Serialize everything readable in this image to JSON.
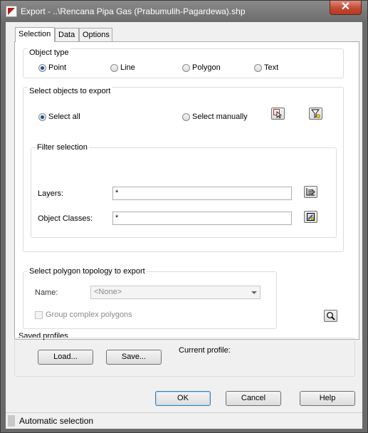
{
  "window": {
    "title": "Export - ..\\Rencana Pipa Gas (Prabumulih-Pagardewa).shp",
    "close_glyph": "✕"
  },
  "tabs": [
    {
      "label": "Selection",
      "active": true
    },
    {
      "label": "Data",
      "active": false
    },
    {
      "label": "Options",
      "active": false
    }
  ],
  "object_type": {
    "label": "Object type",
    "options": [
      {
        "label": "Point",
        "selected": true
      },
      {
        "label": "Line",
        "selected": false
      },
      {
        "label": "Polygon",
        "selected": false
      },
      {
        "label": "Text",
        "selected": false
      }
    ]
  },
  "select_objects": {
    "label": "Select objects to export",
    "select_all": "Select all",
    "select_manually": "Select manually",
    "select_all_checked": true
  },
  "filter_selection": {
    "label": "Filter selection",
    "layers_label": "Layers:",
    "layers_value": "*",
    "classes_label": "Object Classes:",
    "classes_value": "*"
  },
  "polygon_topology": {
    "label": "Select polygon topology to export",
    "name_label": "Name:",
    "name_value": "<None>",
    "group_complex": "Group complex polygons"
  },
  "saved_profiles": {
    "label": "Saved profiles",
    "load": "Load...",
    "save": "Save...",
    "current_profile_label": "Current profile:"
  },
  "buttons": {
    "ok": "OK",
    "cancel": "Cancel",
    "help": "Help"
  },
  "status": {
    "text": "Automatic selection"
  }
}
